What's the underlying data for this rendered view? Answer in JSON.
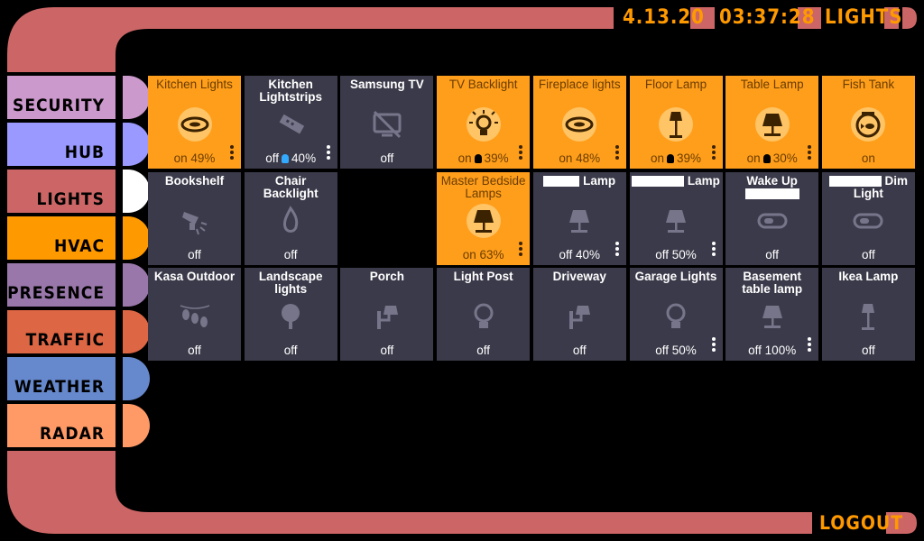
{
  "header": {
    "date": "4.13.20",
    "time": "03:37:28",
    "section": "LIGHTS"
  },
  "footer": {
    "logout_label": "LOGOUT"
  },
  "colors": {
    "frame": "#cc6666",
    "accent_text": "#ff9900",
    "tile_off": "#3b3a4a",
    "tile_on": "#ff9e1b"
  },
  "nav": [
    {
      "label": "SECURITY",
      "color": "#cc99cc"
    },
    {
      "label": "HUB",
      "color": "#9999ff"
    },
    {
      "label": "LIGHTS",
      "color": "#cc6666",
      "active": true
    },
    {
      "label": "HVAC",
      "color": "#ff9900"
    },
    {
      "label": "PRESENCE",
      "color": "#9977aa"
    },
    {
      "label": "TRAFFIC",
      "color": "#dd6644"
    },
    {
      "label": "WEATHER",
      "color": "#6688cc"
    },
    {
      "label": "RADAR",
      "color": "#ff9966"
    }
  ],
  "tiles": [
    {
      "name": "Kitchen Lights",
      "state": "on 49%",
      "on": true,
      "icon": "ceiling-light-icon",
      "menu": true
    },
    {
      "name": "Kitchen Lightstrips",
      "state": "off",
      "extra": "40%",
      "bulb": "#33aaff",
      "on": false,
      "icon": "led-strip-icon",
      "menu": true
    },
    {
      "name": "Samsung TV",
      "state": "off",
      "on": false,
      "icon": "tv-off-icon"
    },
    {
      "name": "TV Backlight",
      "state": "on",
      "extra": "39%",
      "bulb": "#000",
      "on": true,
      "icon": "bulb-on-icon",
      "menu": true
    },
    {
      "name": "Fireplace lights",
      "state": "on 48%",
      "on": true,
      "icon": "ceiling-light-icon",
      "menu": true
    },
    {
      "name": "Floor Lamp",
      "state": "on",
      "extra": "39%",
      "bulb": "#000",
      "on": true,
      "icon": "floor-lamp-icon",
      "menu": true
    },
    {
      "name": "Table Lamp",
      "state": "on",
      "extra": "30%",
      "bulb": "#000",
      "on": true,
      "icon": "table-lamp-icon",
      "menu": true
    },
    {
      "name": "Fish Tank",
      "state": "on",
      "on": true,
      "icon": "fish-bowl-icon"
    },
    {
      "name": "Bookshelf",
      "state": "off",
      "on": false,
      "icon": "spotlight-icon"
    },
    {
      "name": "Chair Backlight",
      "state": "off",
      "on": false,
      "icon": "flame-icon"
    },
    null,
    {
      "name": "Master Bedside Lamps",
      "state": "on 63%",
      "on": true,
      "icon": "table-lamp-icon",
      "menu": true
    },
    {
      "name": "Lamp",
      "redact": 40,
      "state": "off 40%",
      "on": false,
      "icon": "table-lamp-icon",
      "menu": true
    },
    {
      "name": "Lamp",
      "redact": 58,
      "state": "off 50%",
      "on": false,
      "icon": "table-lamp-icon",
      "menu": true
    },
    {
      "name": "Wake Up",
      "redact_below": 60,
      "state": "off",
      "on": false,
      "icon": "toggle-icon"
    },
    {
      "name": "Dim Light",
      "redact": 58,
      "state": "off",
      "on": false,
      "icon": "toggle-icon"
    },
    {
      "name": "Kasa Outdoor",
      "state": "off",
      "on": false,
      "icon": "string-lights-icon"
    },
    {
      "name": "Landscape lights",
      "state": "off",
      "on": false,
      "icon": "tree-icon"
    },
    {
      "name": "Porch",
      "state": "off",
      "on": false,
      "icon": "wall-lamp-icon"
    },
    {
      "name": "Light Post",
      "state": "off",
      "on": false,
      "icon": "bulb-outline-icon"
    },
    {
      "name": "Driveway",
      "state": "off",
      "on": false,
      "icon": "wall-lamp-icon"
    },
    {
      "name": "Garage Lights",
      "state": "off 50%",
      "on": false,
      "icon": "bulb-outline-icon",
      "menu": true
    },
    {
      "name": "Basement table lamp",
      "state": "off 100%",
      "on": false,
      "icon": "table-lamp-icon",
      "menu": true
    },
    {
      "name": "Ikea Lamp",
      "state": "off",
      "on": false,
      "icon": "floor-lamp-icon"
    }
  ]
}
